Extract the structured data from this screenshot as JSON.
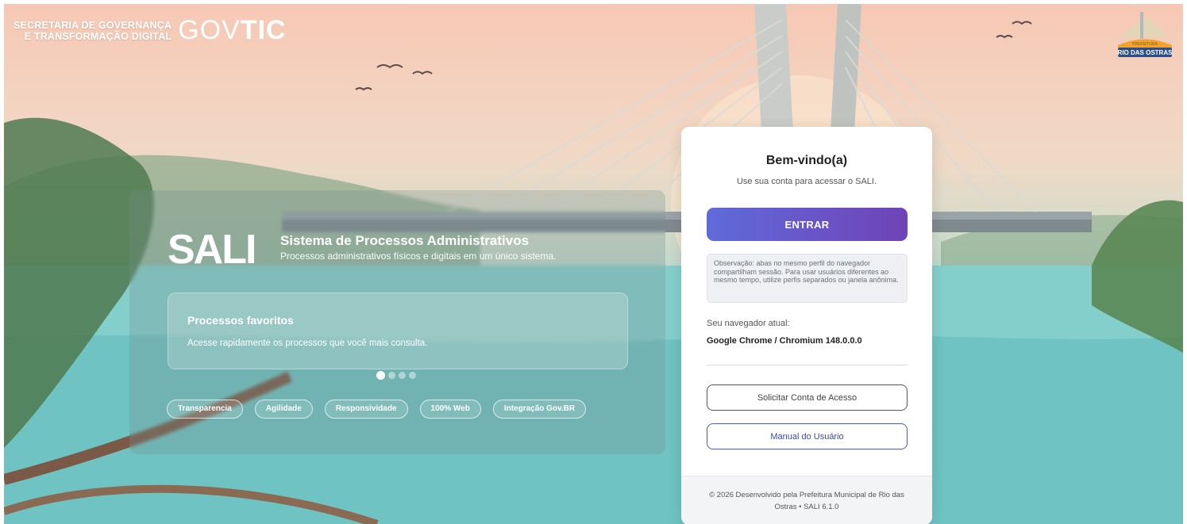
{
  "branding": {
    "org_line1": "SECRETARIA DE GOVERNANÇA",
    "org_line2": "E TRANSFORMAÇÃO DIGITAL",
    "logo_prefix": "GOV",
    "logo_suffix": "TIC"
  },
  "city_badge": {
    "small_text": "PREFEITURA",
    "name": "RIO DAS OSTRAS"
  },
  "hero": {
    "logo_text": "SALI",
    "title": "Sistema de Processos Administrativos",
    "subtitle": "Processos administrativos físicos e digitais em um único sistema.",
    "carousel": {
      "heading": "Processos favoritos",
      "text": "Acesse rapidamente os processos que você mais consulta.",
      "slide_count": 4,
      "active_index": 0
    },
    "tags": [
      "Transparencia",
      "Agilidade",
      "Responsividade",
      "100% Web",
      "Integração Gov.BR"
    ]
  },
  "login": {
    "title": "Bem-vindo(a)",
    "subtitle": "Use sua conta para acessar o SALI.",
    "enter_button": "ENTRAR",
    "note": "Observação: abas no mesmo perfil do navegador compartilham sessão. Para usar usuários diferentes ao mesmo tempo, utilize perfis separados ou janela anônima.",
    "browser_label": "Seu navegador atual:",
    "browser_value": "Google Chrome / Chromium 148.0.0.0",
    "request_button": "Solicitar Conta de Acesso",
    "manual_button": "Manual do Usuário",
    "footer": "© 2026 Desenvolvido pela Prefeitura Municipal de Rio das Ostras • SALI 6.1.0"
  },
  "colors": {
    "primary_gradient_start": "#5f6bd9",
    "primary_gradient_end": "#6e44b6",
    "manual_border": "#4a5bb8"
  }
}
